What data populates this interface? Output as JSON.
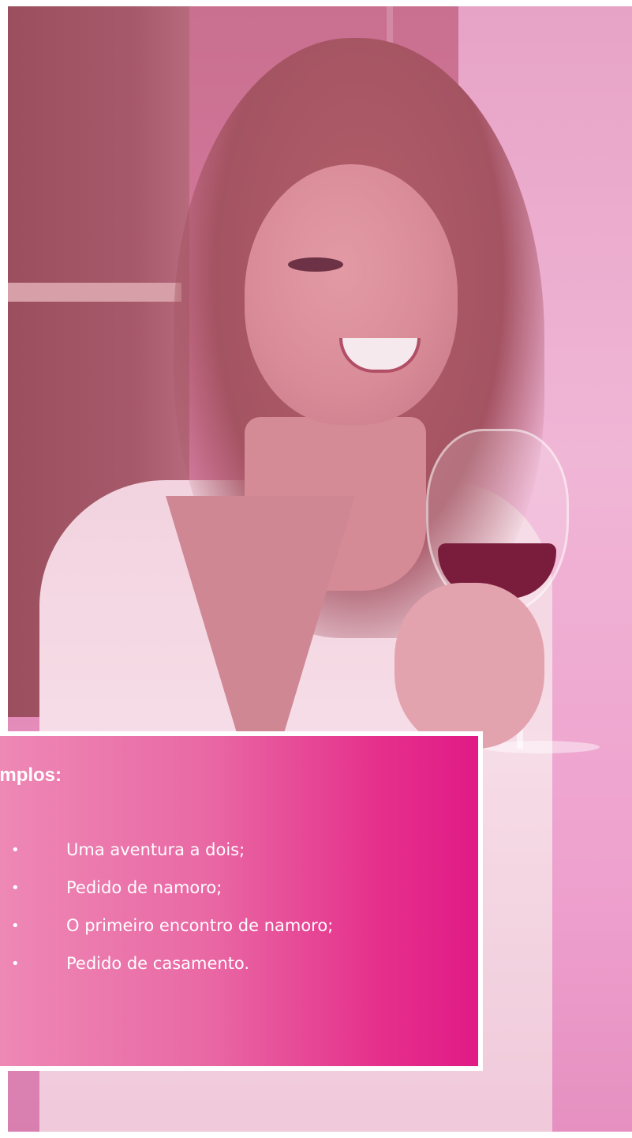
{
  "card": {
    "title": "emplos:",
    "items": [
      {
        "bullet": "•",
        "text": "Uma aventura a dois;"
      },
      {
        "bullet": "•",
        "text": "Pedido de namoro;"
      },
      {
        "bullet": "•",
        "text": "O primeiro encontro de namoro;"
      },
      {
        "bullet": "•",
        "text": "Pedido de casamento."
      }
    ]
  },
  "colors": {
    "card_gradient_start": "#ee8ab6",
    "card_gradient_end": "#e01b86",
    "card_border": "#ffffff",
    "text": "#ffffff"
  }
}
